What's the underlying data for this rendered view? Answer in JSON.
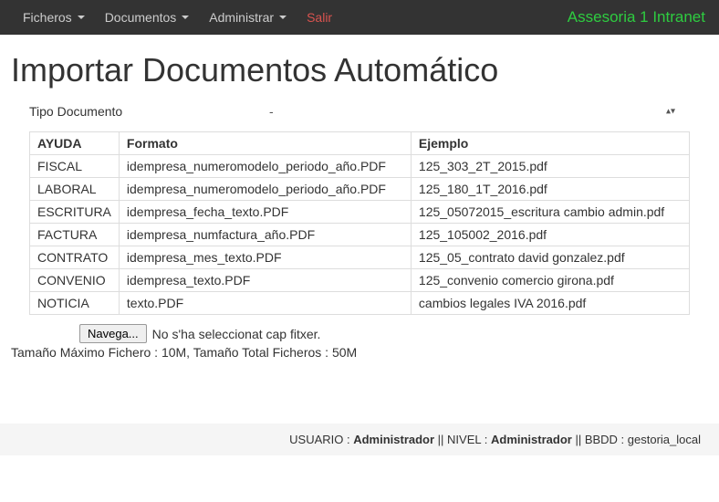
{
  "navbar": {
    "items": [
      {
        "label": "Ficheros",
        "hasCaret": true
      },
      {
        "label": "Documentos",
        "hasCaret": true
      },
      {
        "label": "Administrar",
        "hasCaret": true
      },
      {
        "label": "Salir",
        "hasCaret": false,
        "salir": true
      }
    ],
    "brand": "Assesoria 1 Intranet"
  },
  "page": {
    "title": "Importar Documentos Automático",
    "tipo_label": "Tipo Documento",
    "tipo_value": "-"
  },
  "table": {
    "headers": [
      "AYUDA",
      "Formato",
      "Ejemplo"
    ],
    "rows": [
      {
        "ayuda": "FISCAL",
        "formato": "idempresa_numeromodelo_periodo_año.PDF",
        "ejemplo": "125_303_2T_2015.pdf"
      },
      {
        "ayuda": "LABORAL",
        "formato": "idempresa_numeromodelo_periodo_año.PDF",
        "ejemplo": "125_180_1T_2016.pdf"
      },
      {
        "ayuda": "ESCRITURA",
        "formato": "idempresa_fecha_texto.PDF",
        "ejemplo": "125_05072015_escritura cambio admin.pdf"
      },
      {
        "ayuda": "FACTURA",
        "formato": "idempresa_numfactura_año.PDF",
        "ejemplo": "125_105002_2016.pdf"
      },
      {
        "ayuda": "CONTRATO",
        "formato": "idempresa_mes_texto.PDF",
        "ejemplo": "125_05_contrato david gonzalez.pdf"
      },
      {
        "ayuda": "CONVENIO",
        "formato": "idempresa_texto.PDF",
        "ejemplo": "125_convenio comercio girona.pdf"
      },
      {
        "ayuda": "NOTICIA",
        "formato": "texto.PDF",
        "ejemplo": "cambios legales IVA 2016.pdf"
      }
    ]
  },
  "file": {
    "browse_label": "Navega...",
    "status": "No s'ha seleccionat cap fitxer.",
    "size_info": "Tamaño Máximo Fichero : 10M, Tamaño Total Ficheros : 50M"
  },
  "footer": {
    "usuario_label": "USUARIO : ",
    "usuario_value": "Administrador",
    "nivel_label": "NIVEL : ",
    "nivel_value": "Administrador",
    "bbdd_label": "BBDD : ",
    "bbdd_value": "gestoria_local",
    "sep": " || "
  }
}
